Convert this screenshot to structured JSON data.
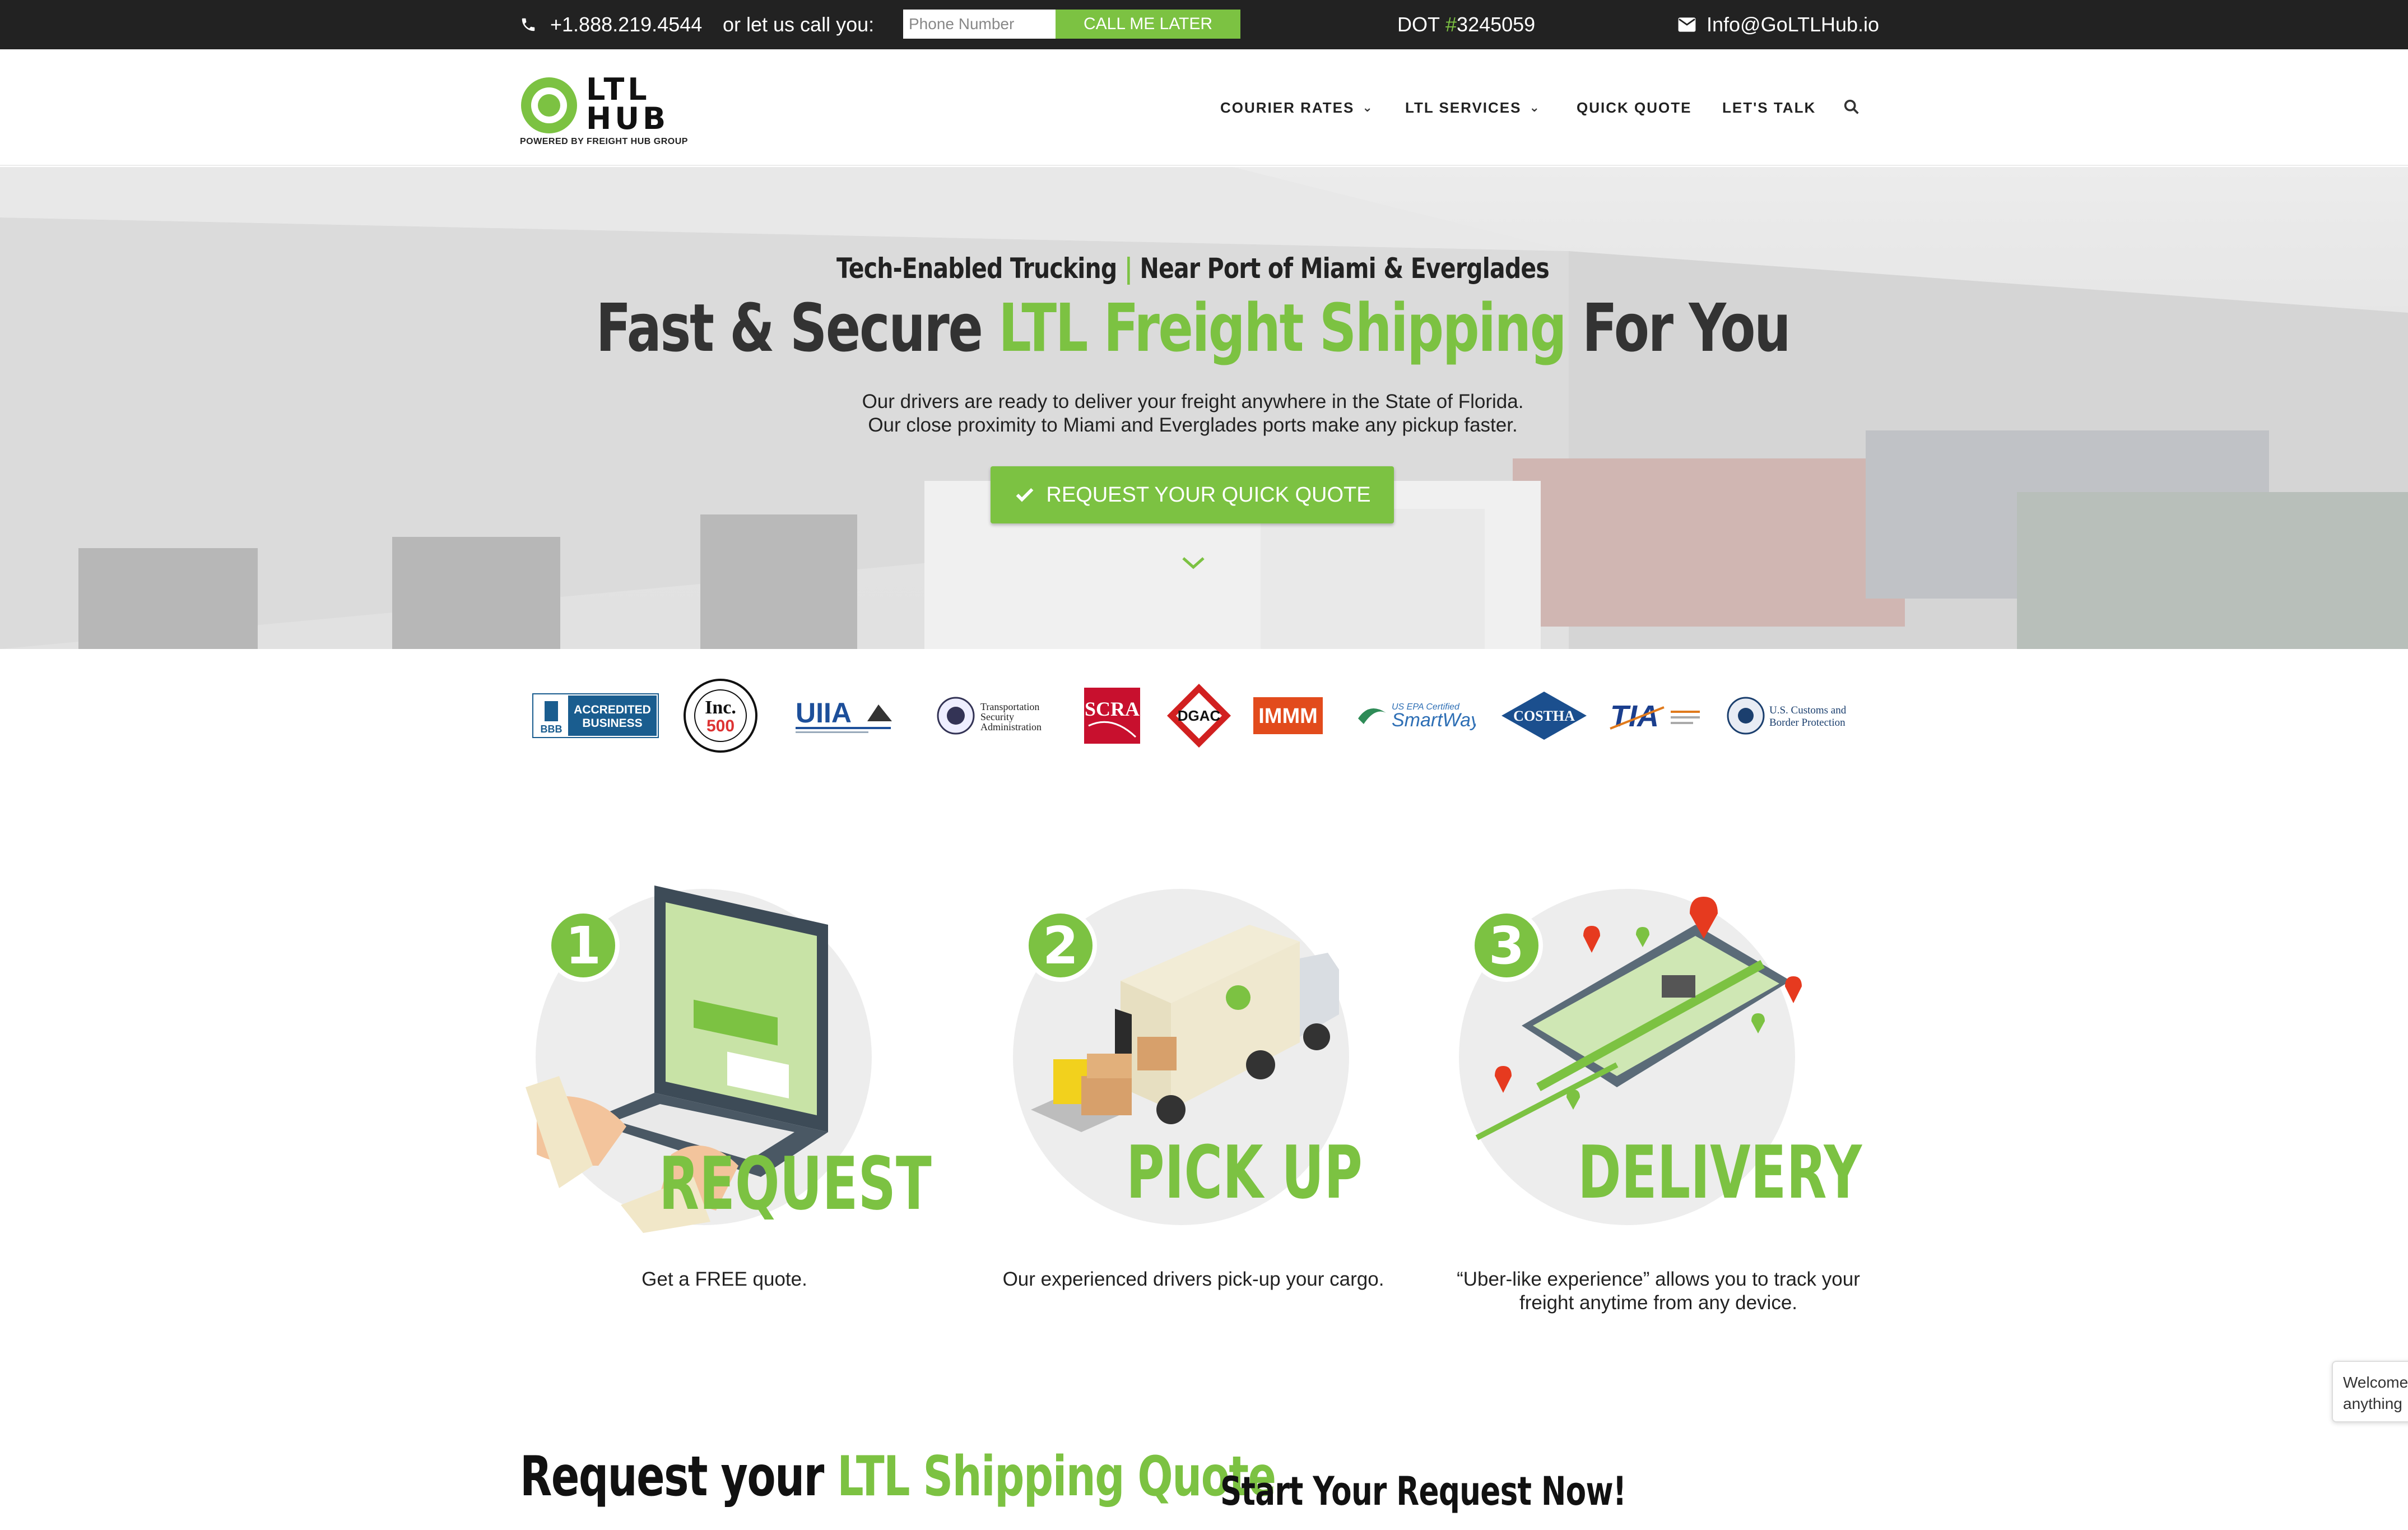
{
  "topbar": {
    "phone": "+1.888.219.4544",
    "call_text": "or let us call you:",
    "phone_placeholder": "Phone Number",
    "call_button": "CALL ME LATER",
    "dot_label": "DOT",
    "dot_hash": "#",
    "dot_number": "3245059",
    "email": "Info@GoLTLHub.io"
  },
  "logo": {
    "line1": "LTL",
    "line2": "HUB",
    "tagline": "POWERED BY FREIGHT HUB GROUP"
  },
  "nav": {
    "items": [
      {
        "label": "COURIER RATES",
        "dropdown": true
      },
      {
        "label": "LTL SERVICES",
        "dropdown": true
      },
      {
        "label": "QUICK QUOTE",
        "dropdown": false
      },
      {
        "label": "LET'S TALK",
        "dropdown": false
      }
    ]
  },
  "hero": {
    "subtitle_a": "Tech-Enabled Trucking",
    "subtitle_sep": "|",
    "subtitle_b": "Near Port of Miami & Everglades",
    "title_a": "Fast & Secure",
    "title_hl": "LTL Freight Shipping",
    "title_b": "For You",
    "para_1": "Our drivers are ready to deliver your freight anywhere in the State of Florida.",
    "para_2": "Our close proximity to Miami and Everglades ports make any pickup faster.",
    "cta": "REQUEST YOUR QUICK QUOTE"
  },
  "badges": {
    "bbb_1": "ACCREDITED",
    "bbb_2": "BUSINESS",
    "bbb_3": "BBB",
    "inc_1": "Inc.",
    "inc_2": "500",
    "uiia": "UIIA",
    "tsa_1": "Transportation",
    "tsa_2": "Security",
    "tsa_3": "Administration",
    "scra": "SCRA",
    "dgac": "DGAC",
    "immm": "IMMM",
    "smartway_1": "US EPA Certified",
    "smartway_2": "SmartWay",
    "costha": "COSTHA",
    "tia": "TIA",
    "cbp_1": "U.S. Customs and",
    "cbp_2": "Border Protection"
  },
  "steps": [
    {
      "num": "1",
      "word": "REQUEST",
      "desc": "Get a FREE quote."
    },
    {
      "num": "2",
      "word": "PICK UP",
      "desc": "Our experienced drivers pick-up your cargo."
    },
    {
      "num": "3",
      "word": "DELIVERY",
      "desc_1": "“Uber-like experience” allows you to track your",
      "desc_2": "freight anytime from any device."
    }
  ],
  "bottom": {
    "left_a": "Request your",
    "left_hl": "LTL Shipping Quote",
    "right": "Start Your Request Now!"
  },
  "chat": {
    "line1": "Welcome",
    "line2": "anything"
  },
  "colors": {
    "accent": "#7cc242",
    "topbar": "#222222"
  }
}
